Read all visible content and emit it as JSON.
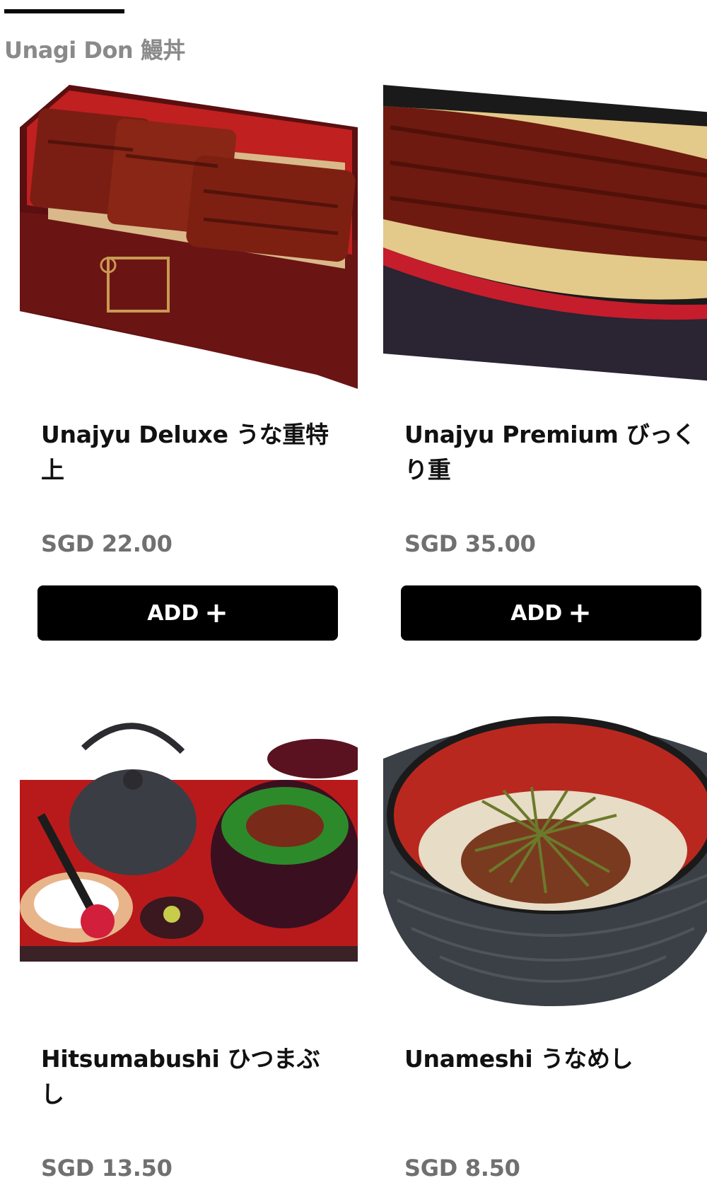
{
  "section": {
    "title": "Unagi Don 鰻丼"
  },
  "add_label": "ADD",
  "items": [
    {
      "name": "Unajyu Deluxe うな重特上",
      "price": "SGD 22.00",
      "image": "unajyu-deluxe-photo"
    },
    {
      "name": "Unajyu Premium びっくり重",
      "price": "SGD 35.00",
      "image": "unajyu-premium-photo"
    },
    {
      "name": "Hitsumabushi ひつまぶし",
      "price": "SGD 13.50",
      "image": "hitsumabushi-photo"
    },
    {
      "name": "Unameshi うなめし",
      "price": "SGD 8.50",
      "image": "unameshi-photo"
    }
  ]
}
